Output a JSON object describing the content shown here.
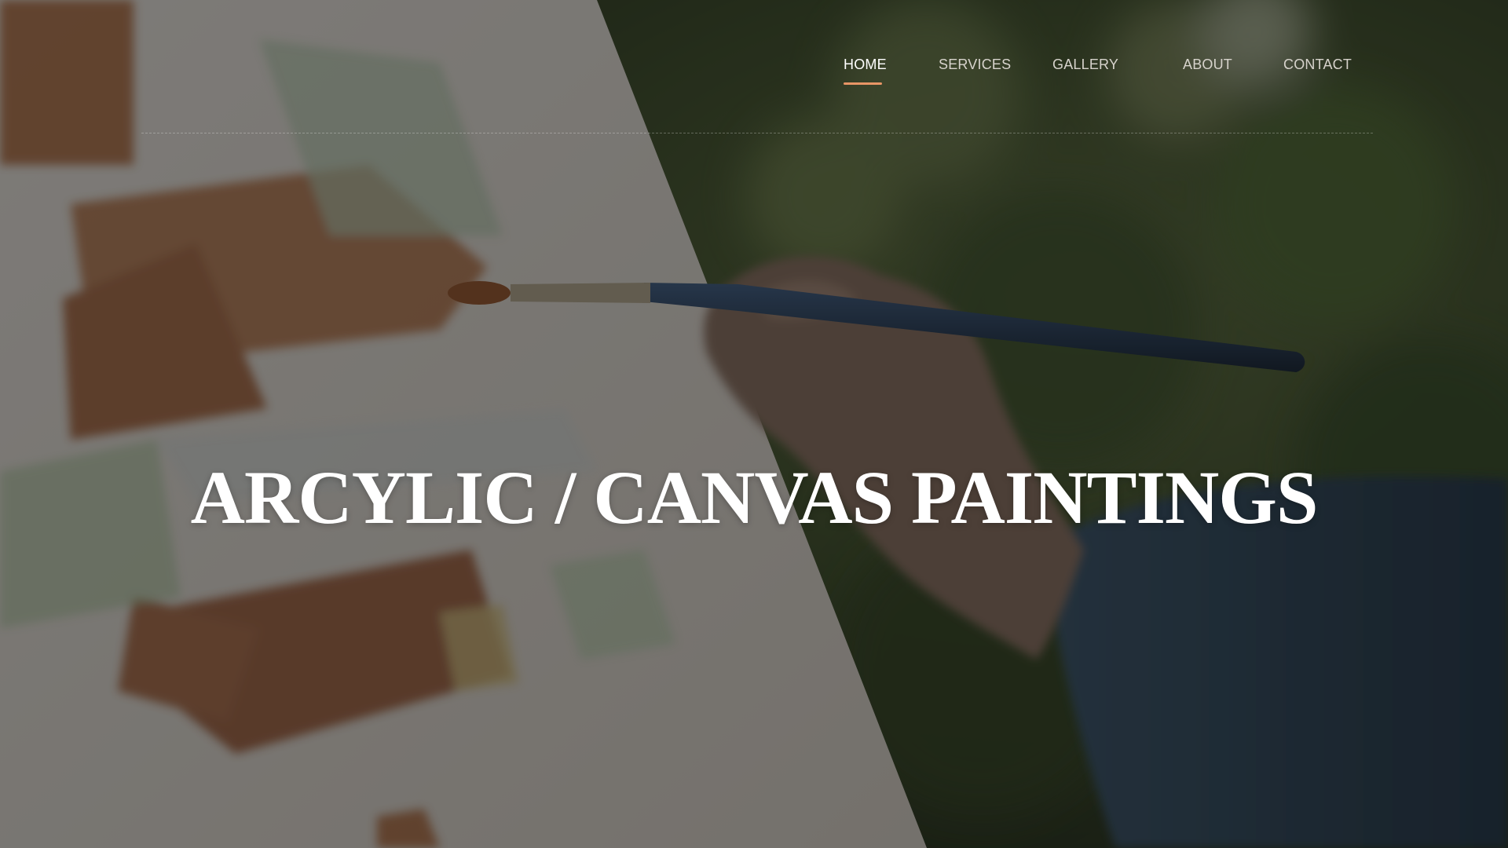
{
  "nav": {
    "items": [
      {
        "label": "HOME",
        "active": true
      },
      {
        "label": "SERVICES",
        "active": false
      },
      {
        "label": "GALLERY",
        "active": false
      },
      {
        "label": "ABOUT",
        "active": false
      },
      {
        "label": "CONTACT",
        "active": false
      }
    ]
  },
  "hero": {
    "headline": "ARCYLIC / CANVAS PAINTINGS"
  },
  "colors": {
    "accent_underline": "#e89566",
    "text_active": "#ffffff",
    "text_inactive": "#d7d3cc",
    "overlay": "rgba(20,20,20,0.52)"
  }
}
